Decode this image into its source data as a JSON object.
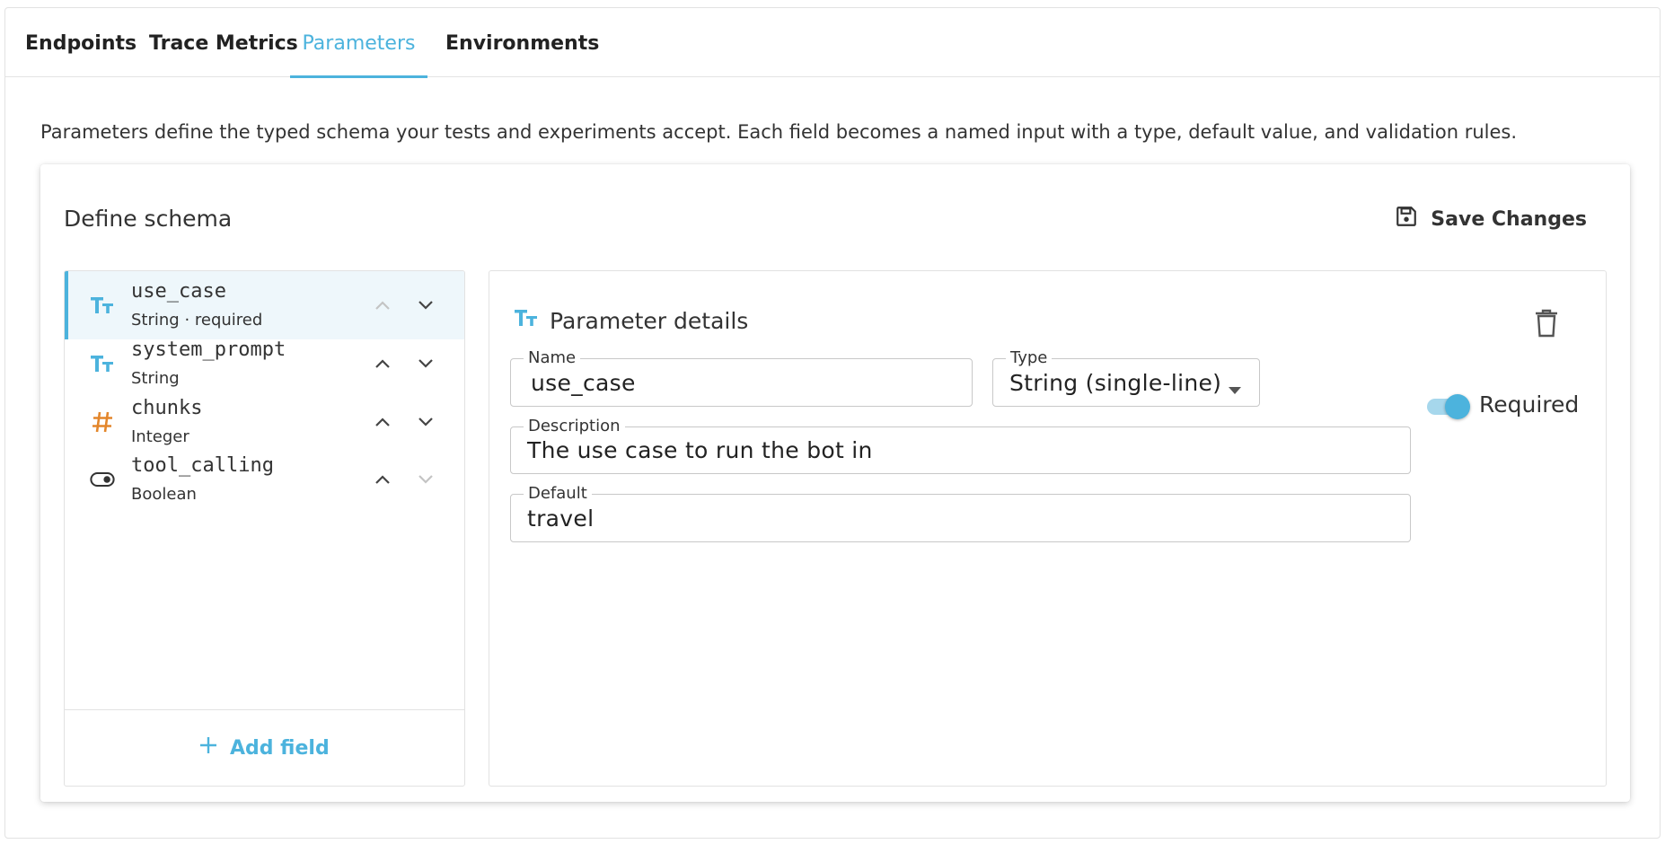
{
  "tabs": [
    {
      "label": "Endpoints",
      "active": false
    },
    {
      "label": "Trace Metrics",
      "active": false
    },
    {
      "label": "Parameters",
      "active": true
    },
    {
      "label": "Environments",
      "active": false
    }
  ],
  "intro_text": "Parameters define the typed schema your tests and experiments accept. Each field becomes a named input with a type, default value, and validation rules.",
  "schema": {
    "title": "Define schema",
    "save_label": "Save Changes",
    "add_field_label": "Add field",
    "fields": [
      {
        "name": "use_case",
        "meta": "String · required",
        "icon": "text-type-icon",
        "selected": true,
        "up_enabled": false,
        "down_enabled": true
      },
      {
        "name": "system_prompt",
        "meta": "String",
        "icon": "text-type-icon",
        "selected": false,
        "up_enabled": true,
        "down_enabled": true
      },
      {
        "name": "chunks",
        "meta": "Integer",
        "icon": "hash-icon",
        "selected": false,
        "up_enabled": true,
        "down_enabled": true
      },
      {
        "name": "tool_calling",
        "meta": "Boolean",
        "icon": "toggle-icon",
        "selected": false,
        "up_enabled": true,
        "down_enabled": false
      }
    ]
  },
  "details": {
    "title": "Parameter details",
    "name_label": "Name",
    "name_value": "use_case",
    "type_label": "Type",
    "type_value": "String (single-line)",
    "required_label": "Required",
    "required_on": true,
    "description_label": "Description",
    "description_value": "The use case to run the bot in",
    "default_label": "Default",
    "default_value": "travel"
  },
  "colors": {
    "accent": "#4cb3dd",
    "integer_icon": "#e3862b",
    "text": "#222222",
    "border": "#c8c8c8"
  }
}
